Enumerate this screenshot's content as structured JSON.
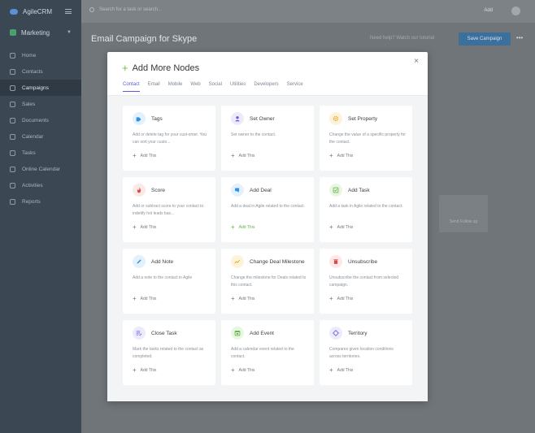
{
  "app": {
    "brand": "AgileCRM",
    "workspace": "Marketing",
    "nav": [
      {
        "label": "Home",
        "active": false
      },
      {
        "label": "Contacts",
        "active": false
      },
      {
        "label": "Campaigns",
        "active": true
      },
      {
        "label": "Sales",
        "active": false
      },
      {
        "label": "Documents",
        "active": false
      },
      {
        "label": "Calendar",
        "active": false
      },
      {
        "label": "Tasks",
        "active": false
      },
      {
        "label": "Online Calendar",
        "active": false
      },
      {
        "label": "Activities",
        "active": false
      },
      {
        "label": "Reports",
        "active": false
      }
    ],
    "search_placeholder": "Search for a task or search...",
    "add_label": "Add",
    "page_title": "Email Campaign for Skype",
    "hint_text": "Need help? Watch our tutorial",
    "save_label": "Save Campaign",
    "more_label": "•••",
    "bg_node_label": "Send Follow up"
  },
  "modal": {
    "title": "Add More Nodes",
    "close_label": "×",
    "tabs": [
      {
        "label": "Contact",
        "active": true
      },
      {
        "label": "Email",
        "active": false
      },
      {
        "label": "Mobile",
        "active": false
      },
      {
        "label": "Web",
        "active": false
      },
      {
        "label": "Social",
        "active": false
      },
      {
        "label": "Utilities",
        "active": false
      },
      {
        "label": "Developers",
        "active": false
      },
      {
        "label": "Service",
        "active": false
      }
    ],
    "add_label": "Add This",
    "cards": [
      {
        "name": "Tags",
        "desc": "Add or delete tag for your cust-omer. You can sort your custo...",
        "icon": "tag-icon",
        "icon_color": "#2f8fe6",
        "icon_bg": "#e3f1fc",
        "add_green": false
      },
      {
        "name": "Set Owner",
        "desc": "Set owner to the contact.",
        "icon": "user-icon",
        "icon_color": "#6a5ad8",
        "icon_bg": "#ecebfb",
        "add_green": false
      },
      {
        "name": "Set Property",
        "desc": "Change the value of a specific property for the contact.",
        "icon": "gear-icon",
        "icon_color": "#e8a817",
        "icon_bg": "#fdf3dc",
        "add_green": false
      },
      {
        "name": "Score",
        "desc": "Add or subtract score to your contact to indetify hot leads bas...",
        "icon": "flame-icon",
        "icon_color": "#e04848",
        "icon_bg": "#fde8e8",
        "add_green": false
      },
      {
        "name": "Add Deal",
        "desc": "Add a deal in Agile related to the contact.",
        "icon": "deal-icon",
        "icon_color": "#2f8fe6",
        "icon_bg": "#e3f1fc",
        "add_green": true
      },
      {
        "name": "Add Task",
        "desc": "Add a task in Agile related to the contact.",
        "icon": "task-check-icon",
        "icon_color": "#5fb546",
        "icon_bg": "#e8f6e2",
        "add_green": false
      },
      {
        "name": "Add Note",
        "desc": "Add a note to the contact in Agile",
        "icon": "pencil-icon",
        "icon_color": "#2f8fe6",
        "icon_bg": "#e3f1fc",
        "add_green": false
      },
      {
        "name": "Change Deal Milestone",
        "desc": "Change the milestone for Deals related to this contact.",
        "icon": "trend-icon",
        "icon_color": "#e8a817",
        "icon_bg": "#fdf3dc",
        "add_green": false
      },
      {
        "name": "Unsubscribe",
        "desc": "Unsubscribe the contact from selected campaign.",
        "icon": "trash-icon",
        "icon_color": "#e04848",
        "icon_bg": "#fde8e8",
        "add_green": false
      },
      {
        "name": "Close Task",
        "desc": "Mark the tasks related to the contact as completed.",
        "icon": "task-list-icon",
        "icon_color": "#6a5ad8",
        "icon_bg": "#ecebfb",
        "add_green": false
      },
      {
        "name": "Add Event",
        "desc": "Add a calendar event related to the contact.",
        "icon": "calendar-icon",
        "icon_color": "#5fb546",
        "icon_bg": "#e8f6e2",
        "add_green": false
      },
      {
        "name": "Territory",
        "desc": "Compares given location conditions across territories.",
        "icon": "diamond-icon",
        "icon_color": "#6a5ad8",
        "icon_bg": "#ecebfb",
        "add_green": false
      }
    ]
  }
}
